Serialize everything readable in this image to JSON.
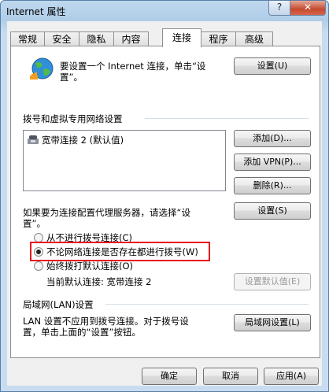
{
  "window": {
    "title": "Internet 属性",
    "help_label": "?",
    "close_label": "✕"
  },
  "tabs": [
    {
      "label": "常规"
    },
    {
      "label": "安全"
    },
    {
      "label": "隐私"
    },
    {
      "label": "内容"
    },
    {
      "label": "连接",
      "active": true
    },
    {
      "label": "程序"
    },
    {
      "label": "高级"
    }
  ],
  "setup": {
    "text_line1": "要设置一个 Internet 连接，单击“设",
    "text_line2": "置”。",
    "button_label": "设置(U)",
    "icon": "globe-network-icon"
  },
  "dialup": {
    "heading": "拨号和虚拟专用网络设置",
    "items": [
      {
        "label": "宽带连接 2 (默认值)",
        "icon": "phone-connection-icon"
      }
    ],
    "add_label": "添加(D)...",
    "add_vpn_label": "添加 VPN(P)...",
    "delete_label": "删除(R)...",
    "proxy_text_line1": "如果要为连接配置代理服务器，请选择“设",
    "proxy_text_line2": "置”。",
    "settings_label": "设置(S)",
    "options": [
      {
        "label": "从不进行拨号连接(C)",
        "checked": false
      },
      {
        "label": "不论网络连接是否存在都进行拨号(W)",
        "checked": true
      },
      {
        "label": "始终拨打默认连接(O)",
        "checked": false
      }
    ],
    "current_default": "当前默认连接:  宽带连接 2",
    "set_default_label": "设置默认值(E)"
  },
  "lan": {
    "heading": "局域网(LAN)设置",
    "text_line1": "LAN 设置不应用到拨号连接。对于拨号设",
    "text_line2": "置，单击上面的“设置”按钮。",
    "button_label": "局域网设置(L)"
  },
  "footer": {
    "ok_label": "确定",
    "cancel_label": "取消",
    "apply_label": "应用(A)"
  },
  "colors": {
    "highlight_border": "#e8141b",
    "title_bar": "#b0cde8"
  }
}
